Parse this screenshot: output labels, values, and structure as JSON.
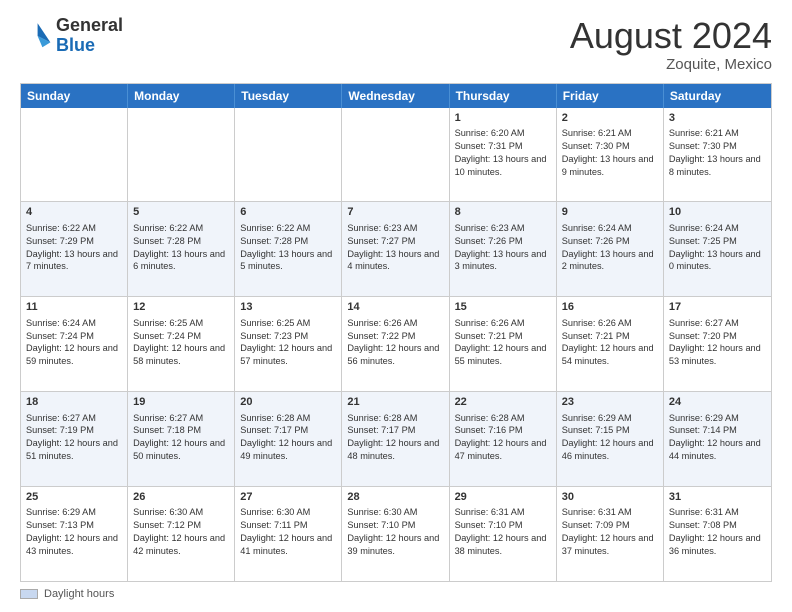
{
  "header": {
    "logo_general": "General",
    "logo_blue": "Blue",
    "month_title": "August 2024",
    "location": "Zoquite, Mexico"
  },
  "footer": {
    "label": "Daylight hours"
  },
  "days_of_week": [
    "Sunday",
    "Monday",
    "Tuesday",
    "Wednesday",
    "Thursday",
    "Friday",
    "Saturday"
  ],
  "weeks": [
    [
      {
        "day": "",
        "info": ""
      },
      {
        "day": "",
        "info": ""
      },
      {
        "day": "",
        "info": ""
      },
      {
        "day": "",
        "info": ""
      },
      {
        "day": "1",
        "info": "Sunrise: 6:20 AM\nSunset: 7:31 PM\nDaylight: 13 hours and 10 minutes."
      },
      {
        "day": "2",
        "info": "Sunrise: 6:21 AM\nSunset: 7:30 PM\nDaylight: 13 hours and 9 minutes."
      },
      {
        "day": "3",
        "info": "Sunrise: 6:21 AM\nSunset: 7:30 PM\nDaylight: 13 hours and 8 minutes."
      }
    ],
    [
      {
        "day": "4",
        "info": "Sunrise: 6:22 AM\nSunset: 7:29 PM\nDaylight: 13 hours and 7 minutes."
      },
      {
        "day": "5",
        "info": "Sunrise: 6:22 AM\nSunset: 7:28 PM\nDaylight: 13 hours and 6 minutes."
      },
      {
        "day": "6",
        "info": "Sunrise: 6:22 AM\nSunset: 7:28 PM\nDaylight: 13 hours and 5 minutes."
      },
      {
        "day": "7",
        "info": "Sunrise: 6:23 AM\nSunset: 7:27 PM\nDaylight: 13 hours and 4 minutes."
      },
      {
        "day": "8",
        "info": "Sunrise: 6:23 AM\nSunset: 7:26 PM\nDaylight: 13 hours and 3 minutes."
      },
      {
        "day": "9",
        "info": "Sunrise: 6:24 AM\nSunset: 7:26 PM\nDaylight: 13 hours and 2 minutes."
      },
      {
        "day": "10",
        "info": "Sunrise: 6:24 AM\nSunset: 7:25 PM\nDaylight: 13 hours and 0 minutes."
      }
    ],
    [
      {
        "day": "11",
        "info": "Sunrise: 6:24 AM\nSunset: 7:24 PM\nDaylight: 12 hours and 59 minutes."
      },
      {
        "day": "12",
        "info": "Sunrise: 6:25 AM\nSunset: 7:24 PM\nDaylight: 12 hours and 58 minutes."
      },
      {
        "day": "13",
        "info": "Sunrise: 6:25 AM\nSunset: 7:23 PM\nDaylight: 12 hours and 57 minutes."
      },
      {
        "day": "14",
        "info": "Sunrise: 6:26 AM\nSunset: 7:22 PM\nDaylight: 12 hours and 56 minutes."
      },
      {
        "day": "15",
        "info": "Sunrise: 6:26 AM\nSunset: 7:21 PM\nDaylight: 12 hours and 55 minutes."
      },
      {
        "day": "16",
        "info": "Sunrise: 6:26 AM\nSunset: 7:21 PM\nDaylight: 12 hours and 54 minutes."
      },
      {
        "day": "17",
        "info": "Sunrise: 6:27 AM\nSunset: 7:20 PM\nDaylight: 12 hours and 53 minutes."
      }
    ],
    [
      {
        "day": "18",
        "info": "Sunrise: 6:27 AM\nSunset: 7:19 PM\nDaylight: 12 hours and 51 minutes."
      },
      {
        "day": "19",
        "info": "Sunrise: 6:27 AM\nSunset: 7:18 PM\nDaylight: 12 hours and 50 minutes."
      },
      {
        "day": "20",
        "info": "Sunrise: 6:28 AM\nSunset: 7:17 PM\nDaylight: 12 hours and 49 minutes."
      },
      {
        "day": "21",
        "info": "Sunrise: 6:28 AM\nSunset: 7:17 PM\nDaylight: 12 hours and 48 minutes."
      },
      {
        "day": "22",
        "info": "Sunrise: 6:28 AM\nSunset: 7:16 PM\nDaylight: 12 hours and 47 minutes."
      },
      {
        "day": "23",
        "info": "Sunrise: 6:29 AM\nSunset: 7:15 PM\nDaylight: 12 hours and 46 minutes."
      },
      {
        "day": "24",
        "info": "Sunrise: 6:29 AM\nSunset: 7:14 PM\nDaylight: 12 hours and 44 minutes."
      }
    ],
    [
      {
        "day": "25",
        "info": "Sunrise: 6:29 AM\nSunset: 7:13 PM\nDaylight: 12 hours and 43 minutes."
      },
      {
        "day": "26",
        "info": "Sunrise: 6:30 AM\nSunset: 7:12 PM\nDaylight: 12 hours and 42 minutes."
      },
      {
        "day": "27",
        "info": "Sunrise: 6:30 AM\nSunset: 7:11 PM\nDaylight: 12 hours and 41 minutes."
      },
      {
        "day": "28",
        "info": "Sunrise: 6:30 AM\nSunset: 7:10 PM\nDaylight: 12 hours and 39 minutes."
      },
      {
        "day": "29",
        "info": "Sunrise: 6:31 AM\nSunset: 7:10 PM\nDaylight: 12 hours and 38 minutes."
      },
      {
        "day": "30",
        "info": "Sunrise: 6:31 AM\nSunset: 7:09 PM\nDaylight: 12 hours and 37 minutes."
      },
      {
        "day": "31",
        "info": "Sunrise: 6:31 AM\nSunset: 7:08 PM\nDaylight: 12 hours and 36 minutes."
      }
    ]
  ]
}
